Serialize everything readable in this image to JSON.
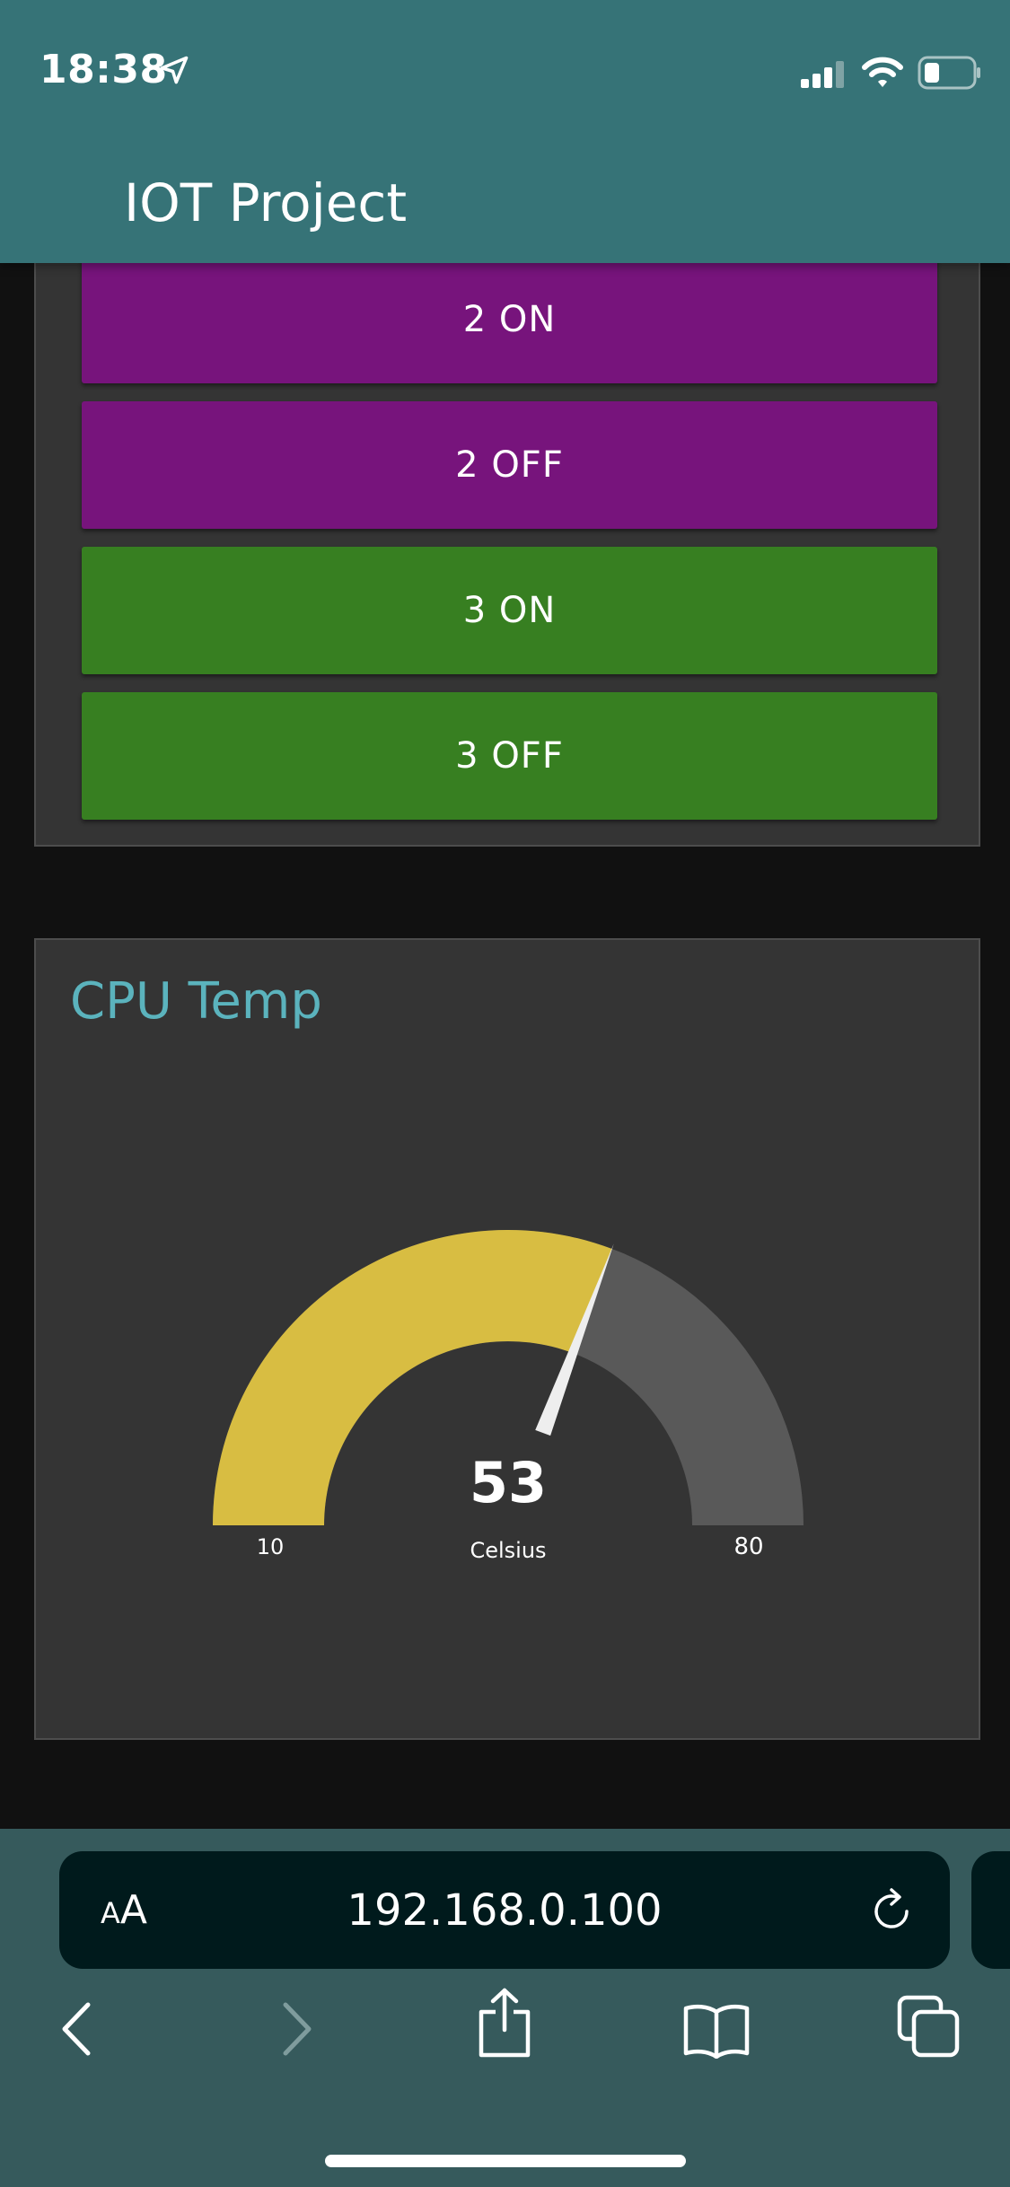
{
  "status_bar": {
    "time": "18:38",
    "icons": [
      "location-arrow-icon",
      "cellular-signal-icon",
      "wifi-icon",
      "battery-icon"
    ]
  },
  "header": {
    "title": "IOT Project"
  },
  "buttons": [
    {
      "label": "2 ON",
      "color": "#77147c"
    },
    {
      "label": "2 OFF",
      "color": "#77147c"
    },
    {
      "label": "3 ON",
      "color": "#377f21"
    },
    {
      "label": "3 OFF",
      "color": "#377f21"
    }
  ],
  "gauge": {
    "title": "CPU Temp",
    "value": "53",
    "unit": "Celsius",
    "min": "10",
    "max": "80",
    "fill_color": "#d8bd42",
    "track_color": "#595959",
    "title_color": "#5bb3bd"
  },
  "browser": {
    "text_size_label_small": "A",
    "text_size_label_large": "A",
    "url": "192.168.0.100",
    "icons": [
      "reload-icon",
      "back-icon",
      "forward-icon",
      "share-icon",
      "bookmarks-icon",
      "tabs-icon"
    ]
  }
}
